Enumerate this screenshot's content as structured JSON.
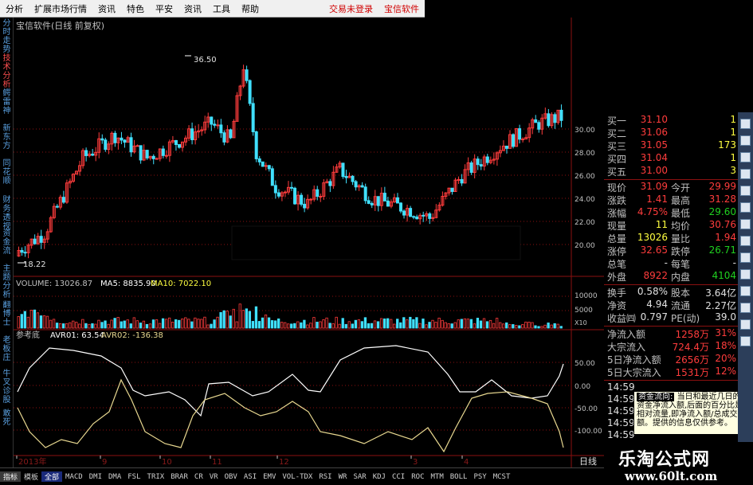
{
  "menu": {
    "items": [
      "分析",
      "扩展市场行情",
      "资讯",
      "特色",
      "平安",
      "资讯",
      "工具",
      "帮助"
    ],
    "login_status": "交易未登录",
    "brand": "宝信软件"
  },
  "left_tabs": [
    {
      "label": "分时走势",
      "active": false
    },
    {
      "label": "技术分析",
      "active": true
    },
    {
      "label": "鳄雷神",
      "active": false
    },
    {
      "label": "新东方",
      "active": false
    },
    {
      "label": "同花顺",
      "active": false
    },
    {
      "label": "财务透视",
      "active": false
    },
    {
      "label": "资金流",
      "active": false
    },
    {
      "label": "主题分析",
      "active": false
    },
    {
      "label": "翻博士",
      "active": false
    },
    {
      "label": "老板庄",
      "active": false
    },
    {
      "label": "牛叉诊股",
      "active": false
    },
    {
      "label": "敢死",
      "active": false
    }
  ],
  "chart_title": "宝信软件(日线 前复权)",
  "price_chart": {
    "high_label": "36.50",
    "low_label": "18.22",
    "axis_ticks": [
      "30.00",
      "28.00",
      "26.00",
      "24.00",
      "22.00",
      "20.00"
    ]
  },
  "volume": {
    "label_volume": "VOLUME: 13026.87",
    "label_ma5": "MA5: 8835.90",
    "label_ma10": "MA10: 7022.10",
    "axis_ticks": [
      "10000",
      "5000"
    ],
    "unit": "X10"
  },
  "indicator": {
    "name": "参考底",
    "label_avr01": "AVR01: 63.54",
    "label_avr02": "AVR02: -136.38",
    "axis_ticks": [
      "50.00",
      "0.00",
      "-50.00",
      "-100.00"
    ]
  },
  "date_axis": [
    "2013年",
    "9",
    "10",
    "11",
    "12",
    "3",
    "4"
  ],
  "day_label": "日线",
  "quote": {
    "bids": [
      {
        "label": "买一",
        "price": "31.10",
        "vol": "1"
      },
      {
        "label": "买二",
        "price": "31.06",
        "vol": "1"
      },
      {
        "label": "买三",
        "price": "31.05",
        "vol": "173"
      },
      {
        "label": "买四",
        "price": "31.04",
        "vol": "1"
      },
      {
        "label": "买五",
        "price": "31.00",
        "vol": "3"
      }
    ],
    "rows": [
      {
        "l1": "现价",
        "v1": "31.09",
        "l2": "今开",
        "v2": "29.99"
      },
      {
        "l1": "涨跌",
        "v1": "1.41",
        "l2": "最高",
        "v2": "31.28"
      },
      {
        "l1": "涨幅",
        "v1": "4.75%",
        "l2": "最低",
        "v2": "29.60"
      },
      {
        "l1": "现量",
        "v1": "11",
        "l2": "均价",
        "v2": "30.76"
      },
      {
        "l1": "总量",
        "v1": "13026",
        "l2": "量比",
        "v2": "1.94"
      },
      {
        "l1": "涨停",
        "v1": "32.65",
        "l2": "跌停",
        "v2": "26.71"
      },
      {
        "l1": "总笔",
        "v1": "-",
        "l2": "每笔",
        "v2": "-"
      },
      {
        "l1": "外盘",
        "v1": "8922",
        "l2": "内盘",
        "v2": "4104"
      }
    ],
    "rows2": [
      {
        "l1": "换手",
        "v1": "0.58%",
        "l2": "股本",
        "v2": "3.64亿"
      },
      {
        "l1": "净资",
        "v1": "4.94",
        "l2": "流通",
        "v2": "2.27亿"
      },
      {
        "l1": "收益㈣",
        "v1": "0.797",
        "l2": "PE(动)",
        "v2": "39.0"
      }
    ],
    "flows": [
      {
        "label": "净流入额",
        "value": "1258万",
        "pct": "31%"
      },
      {
        "label": "大宗流入",
        "value": "724.4万",
        "pct": "18%"
      },
      {
        "label": "5日净流入额",
        "value": "2656万",
        "pct": "20%"
      },
      {
        "label": "5日大宗流入",
        "value": "1531万",
        "pct": "12%"
      }
    ],
    "ticks": [
      "14:59",
      "14:59",
      "14:59",
      "14:59",
      "14:59"
    ]
  },
  "tooltip": {
    "title": "资金流向:",
    "text": "当日和最近几日的资金净流入额,后面的百分比是相对流量,即净流入额/总成交额。提供的信息仅供参考。"
  },
  "tabbar": [
    "指标",
    "模板",
    "全部",
    "MACD",
    "DMI",
    "DMA",
    "FSL",
    "TRIX",
    "BRAR",
    "CR",
    "VR",
    "OBV",
    "ASI",
    "EMV",
    "VOL-TDX",
    "RSI",
    "WR",
    "SAR",
    "KDJ",
    "CCI",
    "ROC",
    "MTM",
    "BOLL",
    "PSY",
    "MCST"
  ],
  "watermark": {
    "line1": "乐淘公式网",
    "line2": "www.60lt.com"
  },
  "colors": {
    "up": "#ff3c3c",
    "down": "#40e0ff",
    "grid": "#8b1010",
    "ma5": "#ffffff",
    "ma10": "#ffff40",
    "avr01": "#ffffff",
    "avr02": "#e8d890"
  }
}
